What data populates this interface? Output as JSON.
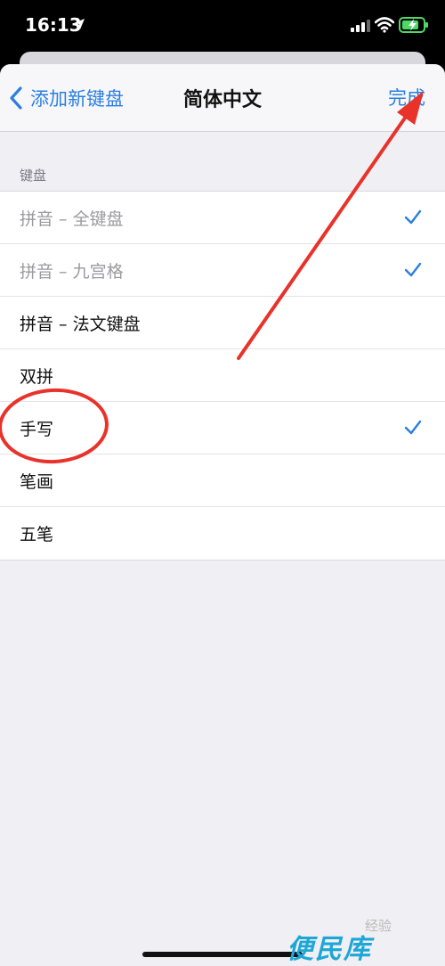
{
  "status_bar": {
    "time": "16:13"
  },
  "nav": {
    "back_label": "添加新键盘",
    "title": "简体中文",
    "done_label": "完成"
  },
  "section_header": "键盘",
  "keyboards": [
    {
      "label": "拼音 – 全键盘",
      "checked": true,
      "disabled": true
    },
    {
      "label": "拼音 – 九宫格",
      "checked": true,
      "disabled": true
    },
    {
      "label": "拼音 – 法文键盘",
      "checked": false,
      "disabled": false
    },
    {
      "label": "双拼",
      "checked": false,
      "disabled": false
    },
    {
      "label": "手写",
      "checked": true,
      "disabled": false
    },
    {
      "label": "笔画",
      "checked": false,
      "disabled": false
    },
    {
      "label": "五笔",
      "checked": false,
      "disabled": false
    }
  ],
  "colors": {
    "accent": "#2b7fe0",
    "annotation": "#e8322a",
    "battery": "#4cd964"
  },
  "watermark": {
    "text": "经验",
    "brand": "便民库"
  }
}
